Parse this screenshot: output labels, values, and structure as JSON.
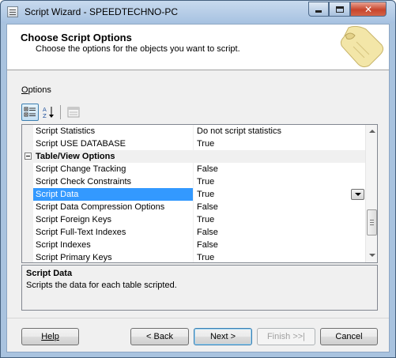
{
  "window": {
    "title": "Script Wizard - SPEEDTECHNO-PC",
    "controls": {
      "minimize": "–",
      "maximize": "□",
      "close": "✕"
    }
  },
  "header": {
    "title": "Choose Script Options",
    "subtitle": "Choose the options for the objects you want to script."
  },
  "options_label": "Options",
  "options_label_accel": "O",
  "options_label_rest": "ptions",
  "toolbar": {
    "categorized_icon": "categorized-icon",
    "alphabetical_icon": "alphabetical-sort-icon",
    "property_pages_icon": "property-pages-icon"
  },
  "grid": {
    "rows": [
      {
        "type": "prop",
        "name": "Script Statistics",
        "value": "Do not script statistics"
      },
      {
        "type": "prop",
        "name": "Script USE DATABASE",
        "value": "True"
      },
      {
        "type": "category",
        "name": "Table/View Options",
        "value": ""
      },
      {
        "type": "prop",
        "name": "Script Change Tracking",
        "value": "False"
      },
      {
        "type": "prop",
        "name": "Script Check Constraints",
        "value": "True"
      },
      {
        "type": "prop",
        "name": "Script Data",
        "value": "True",
        "selected": true
      },
      {
        "type": "prop",
        "name": "Script Data Compression Options",
        "value": "False"
      },
      {
        "type": "prop",
        "name": "Script Foreign Keys",
        "value": "True"
      },
      {
        "type": "prop",
        "name": "Script Full-Text Indexes",
        "value": "False"
      },
      {
        "type": "prop",
        "name": "Script Indexes",
        "value": "False"
      },
      {
        "type": "prop",
        "name": "Script Primary Keys",
        "value": "True"
      }
    ]
  },
  "description": {
    "title": "Script Data",
    "text": "Scripts the data for each table scripted."
  },
  "buttons": {
    "help": "Help",
    "back": "< Back",
    "next": "Next >",
    "finish": "Finish >>|",
    "cancel": "Cancel"
  },
  "colors": {
    "selection": "#3399ff",
    "window_frame": "#a9c3df"
  }
}
